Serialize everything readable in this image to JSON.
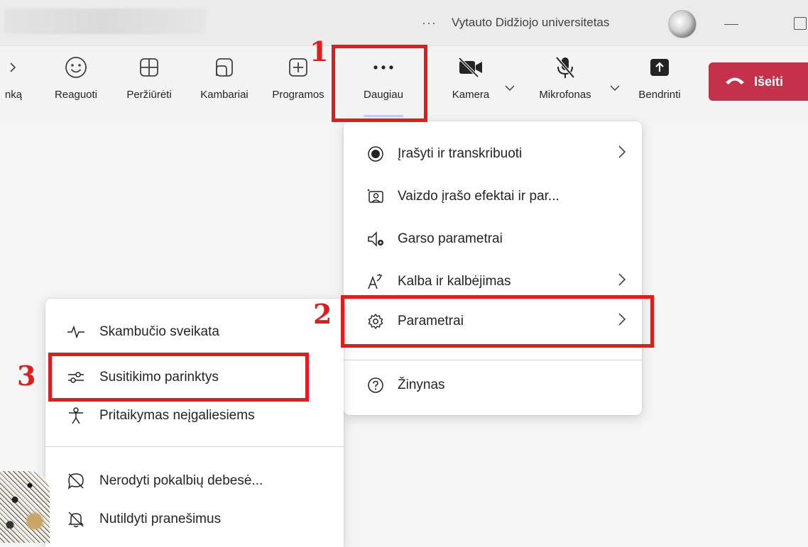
{
  "titlebar": {
    "more": "···",
    "org_name": "Vytauto Didžiojo universitetas"
  },
  "toolbar": {
    "partial_left": "nką",
    "react": "Reaguoti",
    "view": "Peržiūrėti",
    "rooms": "Kambariai",
    "apps": "Programos",
    "more_label": "Daugiau",
    "camera": "Kamera",
    "mic": "Mikrofonas",
    "share": "Bendrinti",
    "leave": "Išeiti"
  },
  "annotations": [
    "1",
    "2",
    "3"
  ],
  "more_menu": {
    "items": [
      {
        "label": "Įrašyti ir transkribuoti",
        "icon": "record-icon",
        "arrow": "›"
      },
      {
        "label": "Vaizdo įrašo efektai ir par...",
        "icon": "video-effects-icon"
      },
      {
        "label": "Garso parametrai",
        "icon": "speaker-settings-icon"
      },
      {
        "label": "Kalba ir kalbėjimas",
        "icon": "language-icon",
        "arrow": "›"
      },
      {
        "label": "Parametrai",
        "icon": "gear-icon",
        "arrow": "›"
      },
      {
        "label": "Žinynas",
        "icon": "help-icon"
      }
    ]
  },
  "settings_menu": {
    "items": [
      {
        "label": "Skambučio sveikata",
        "icon": "call-health-icon"
      },
      {
        "label": "Susitikimo parinktys",
        "icon": "meeting-options-icon"
      },
      {
        "label": "Pritaikymas neįgaliesiems",
        "icon": "accessibility-icon"
      },
      {
        "label": "Nerodyti pokalbių debesė...",
        "icon": "chat-bubbles-off-icon"
      },
      {
        "label": "Nutildyti pranešimus",
        "icon": "bell-off-icon"
      }
    ]
  },
  "colors": {
    "leave_bg": "#c4314b",
    "annotation": "#e21b1b"
  }
}
